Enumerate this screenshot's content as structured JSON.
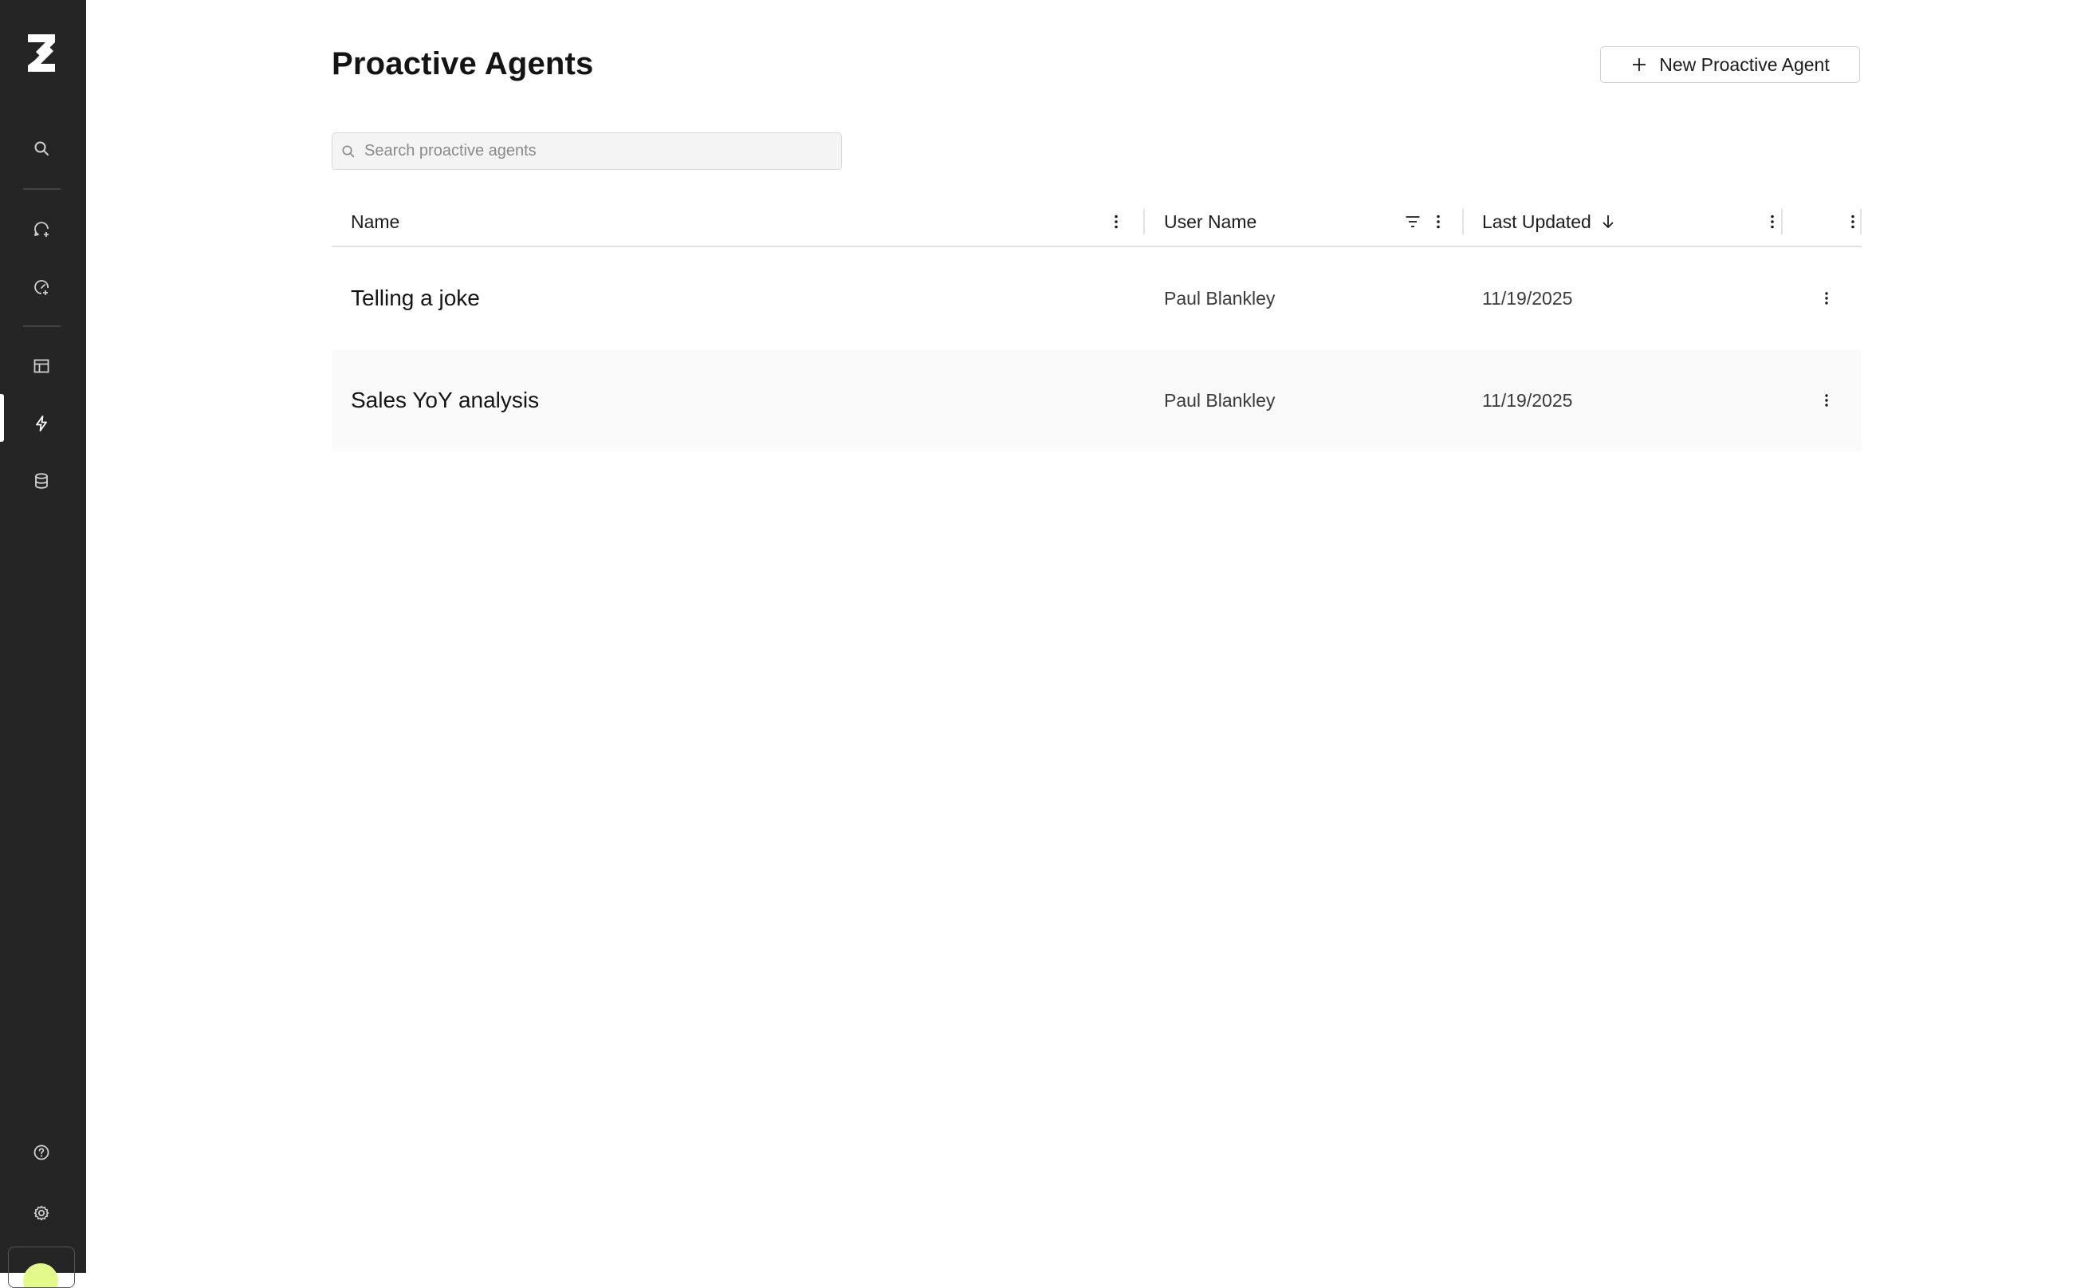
{
  "app": {
    "sidebar": {
      "logo": "brand-logo",
      "items": [
        {
          "icon": "search-icon"
        },
        {
          "icon": "chat-add-icon"
        },
        {
          "icon": "gauge-icon"
        },
        {
          "icon": "table-icon"
        },
        {
          "icon": "bolt-icon",
          "active": true
        },
        {
          "icon": "database-icon"
        }
      ],
      "bottom": [
        {
          "icon": "help-icon"
        },
        {
          "icon": "gear-icon"
        }
      ]
    }
  },
  "main": {
    "title": "Proactive Agents",
    "new_button": {
      "label": "New Proactive Agent",
      "icon": "plus-icon"
    },
    "search": {
      "placeholder": "Search proactive agents",
      "value": ""
    }
  },
  "table": {
    "columns": [
      {
        "label": "Name"
      },
      {
        "label": "User Name",
        "filter": true
      },
      {
        "label": "Last Updated",
        "sorted": "descending"
      }
    ],
    "rows": [
      {
        "name": "Telling a joke",
        "user": "Paul Blankley",
        "updated": "11/19/2025"
      },
      {
        "name": "Sales YoY analysis",
        "user": "Paul Blankley",
        "updated": "11/19/2025"
      }
    ]
  },
  "colors": {
    "sidebar_bg": "#252525",
    "avatar": "#e3f98a",
    "alt_row": "#fafafa"
  }
}
